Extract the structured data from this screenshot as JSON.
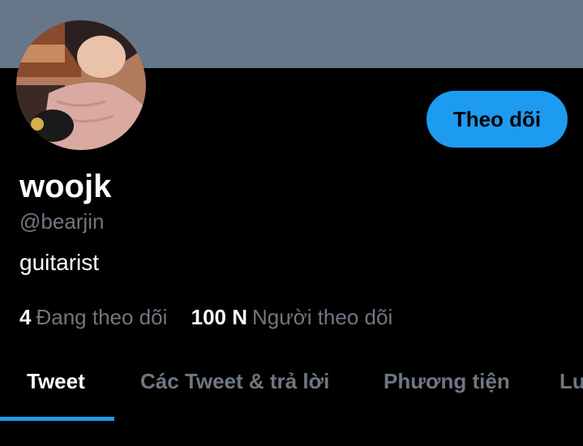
{
  "colors": {
    "banner": "#66778a",
    "accent": "#1d9bf0",
    "text_primary": "#ffffff",
    "text_secondary": "#6e7781",
    "tab_inactive": "#6e7781",
    "background": "#000000"
  },
  "profile": {
    "display_name": "woojk",
    "handle": "@bearjin",
    "bio": "guitarist",
    "follow_button_label": "Theo dõi"
  },
  "stats": {
    "following_count": "4",
    "following_label": "Đang theo dõi",
    "followers_count": "100 N",
    "followers_label": "Người theo dõi"
  },
  "tabs": [
    {
      "label": "Tweet",
      "active": true
    },
    {
      "label": "Các Tweet & trả lời",
      "active": false
    },
    {
      "label": "Phương tiện",
      "active": false
    },
    {
      "label": "Lư",
      "active": false
    }
  ]
}
